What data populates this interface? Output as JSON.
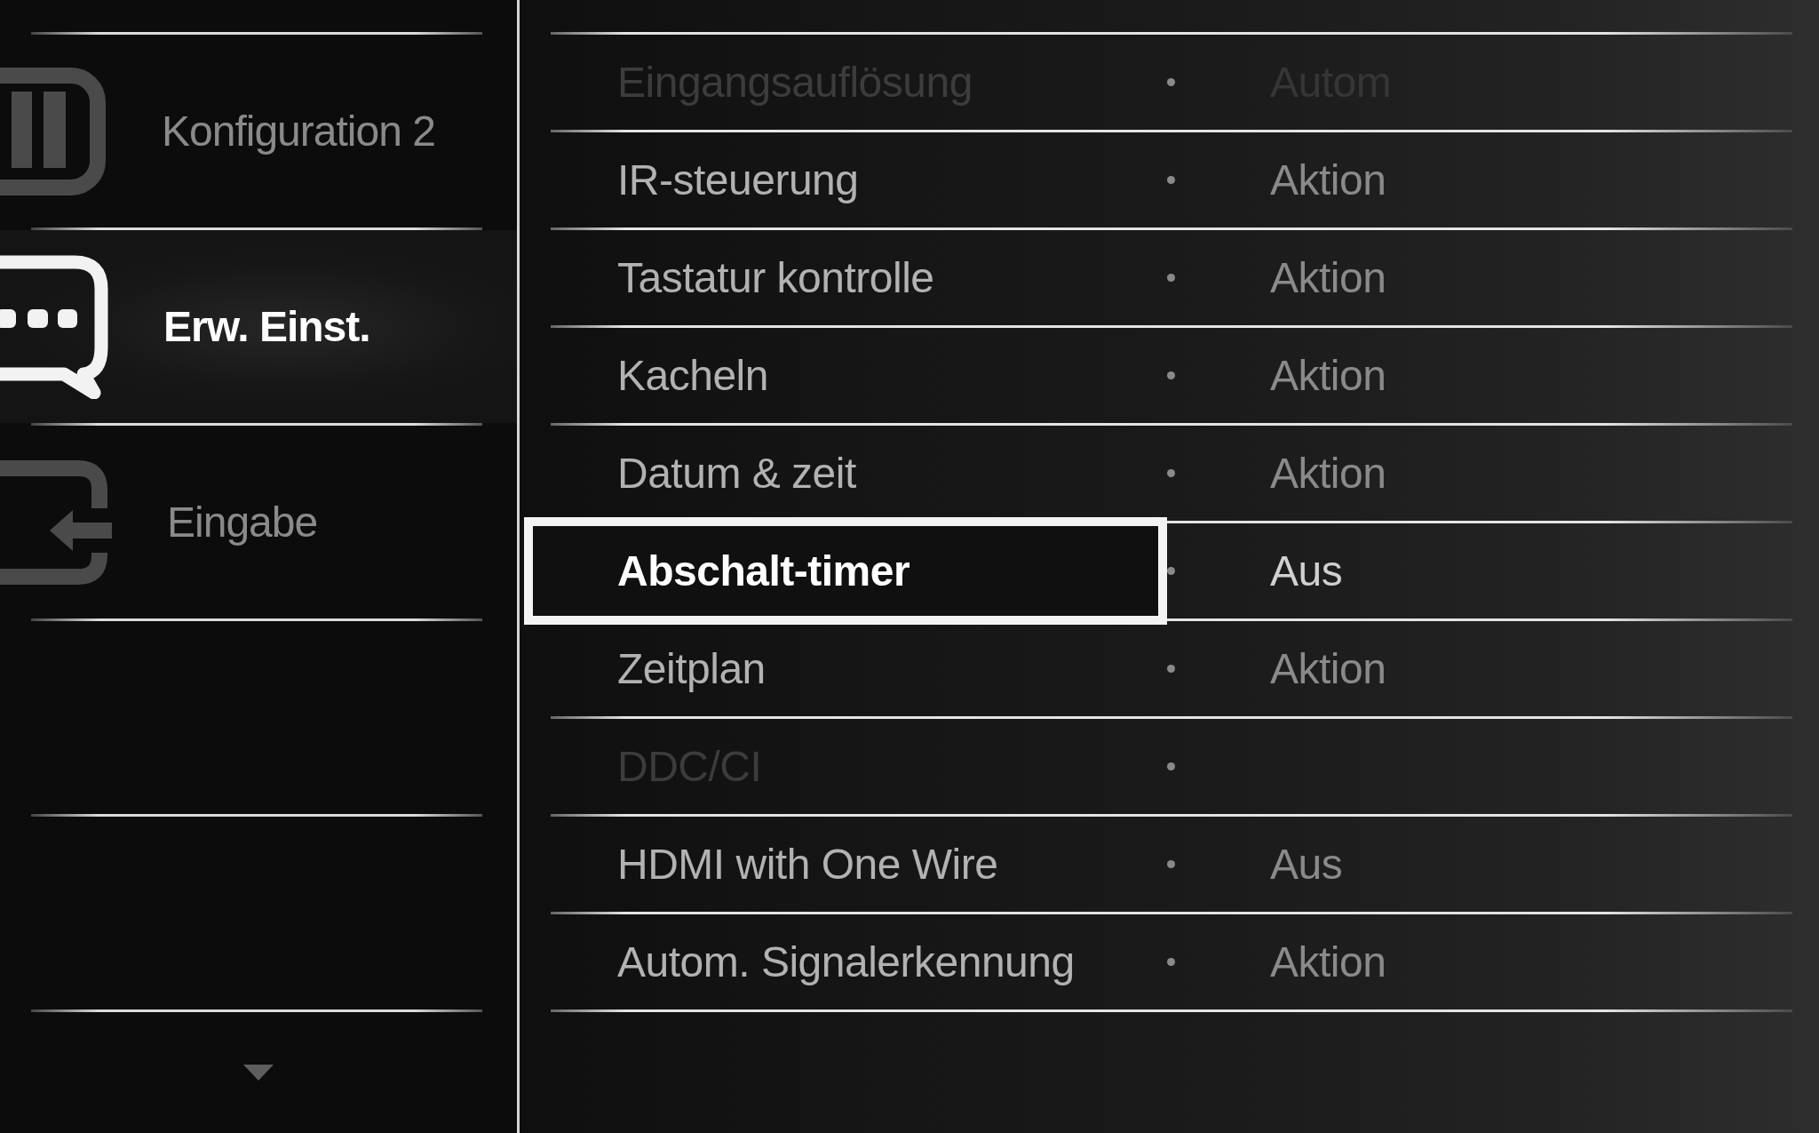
{
  "sidebar": {
    "items": [
      {
        "label": "Konfiguration 2",
        "selected": false
      },
      {
        "label": "Erw. Einst.",
        "selected": true
      },
      {
        "label": "Eingabe",
        "selected": false
      }
    ]
  },
  "settings": {
    "items": [
      {
        "label": "Eingangsauflösung",
        "value": "Autom",
        "selected": false,
        "disabled": true
      },
      {
        "label": "IR-steuerung",
        "value": "Aktion",
        "selected": false,
        "disabled": false
      },
      {
        "label": "Tastatur kontrolle",
        "value": "Aktion",
        "selected": false,
        "disabled": false
      },
      {
        "label": "Kacheln",
        "value": "Aktion",
        "selected": false,
        "disabled": false
      },
      {
        "label": "Datum & zeit",
        "value": "Aktion",
        "selected": false,
        "disabled": false
      },
      {
        "label": "Abschalt-timer",
        "value": "Aus",
        "selected": true,
        "disabled": false
      },
      {
        "label": "Zeitplan",
        "value": "Aktion",
        "selected": false,
        "disabled": false
      },
      {
        "label": "DDC/CI",
        "selected": false,
        "disabled": true
      },
      {
        "label": "HDMI with One Wire",
        "value": "Aus",
        "selected": false,
        "disabled": false
      },
      {
        "label": "Autom. Signalerkennung",
        "value": "Aktion",
        "selected": false,
        "disabled": false
      }
    ]
  }
}
